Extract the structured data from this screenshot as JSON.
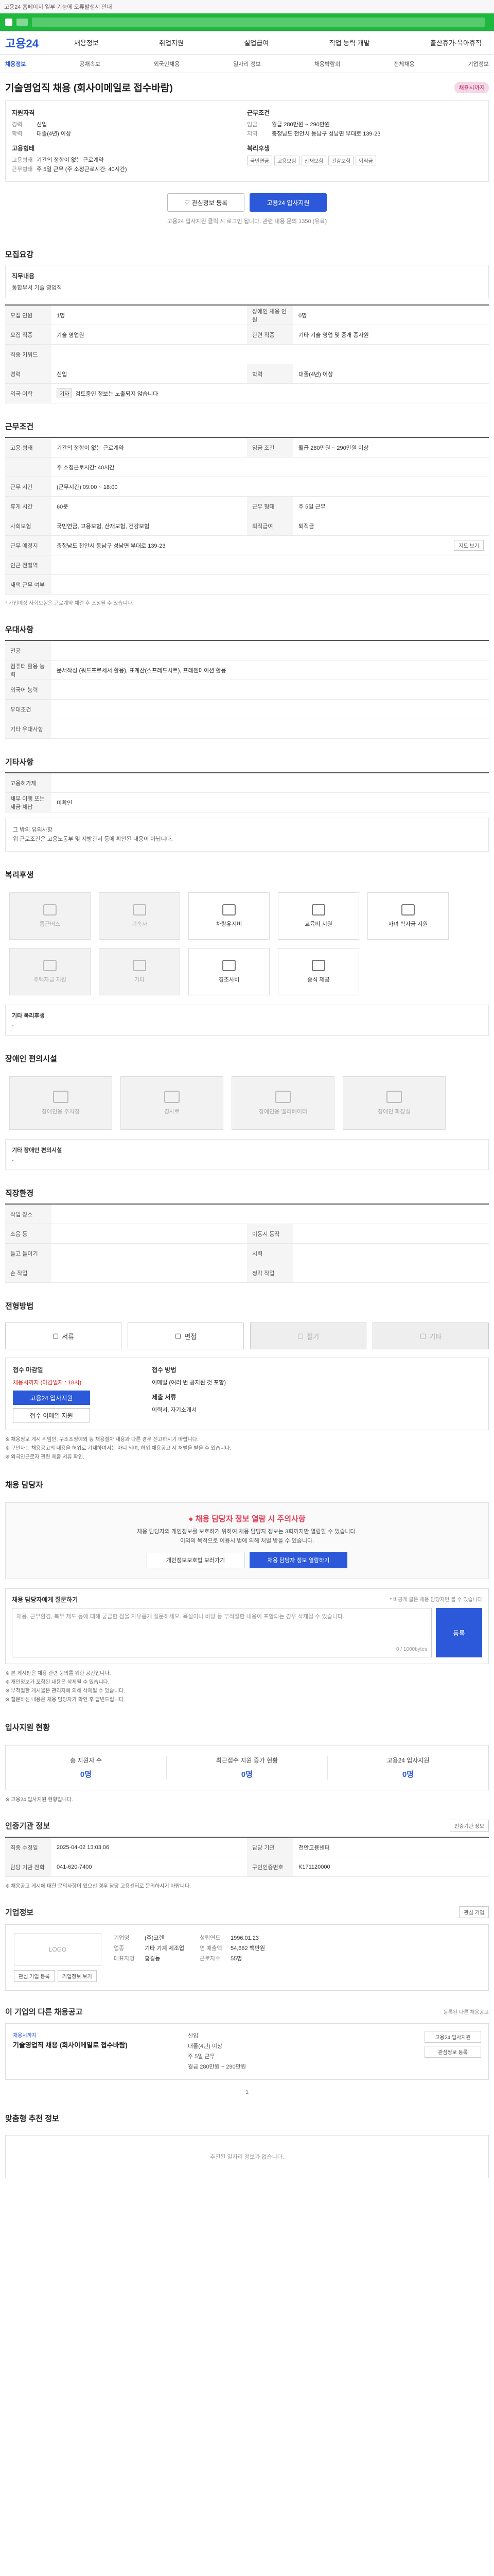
{
  "notice": {
    "text": "고용24 홈페이지 일부 기능에 오류발생시 안내"
  },
  "site": {
    "logo": "고용24"
  },
  "gnb": {
    "items": [
      "채용정보",
      "취업지원",
      "실업급여",
      "직업 능력 개발",
      "출산휴가·육아휴직"
    ]
  },
  "snb": {
    "items": [
      "채용정보",
      "공채속보",
      "외국인채용",
      "일자리 정보",
      "채용박람회",
      "전체채용",
      "기업정보"
    ]
  },
  "job": {
    "title": "기술영업직 채용 (회사이메일로 접수바람)",
    "badge": "채용시까지",
    "qualifications": {
      "heading": "지원자격",
      "rows": [
        {
          "k": "경력",
          "v": "신입"
        },
        {
          "k": "학력",
          "v": "대졸(4년) 이상"
        }
      ]
    },
    "conditions": {
      "heading": "근무조건",
      "rows": [
        {
          "k": "임금",
          "v": "월급 280만원 ~ 290만원"
        },
        {
          "k": "지역",
          "v": "충청남도 천안시 동남구 성남면 부대로 139-23"
        }
      ]
    },
    "employment": {
      "heading": "고용형태",
      "rows": [
        {
          "k": "고용형태",
          "v": "기간의 정함이 없는 근로계약"
        },
        {
          "k": "근무형태",
          "v": "주 5일 근무 (주 소정근로시간: 40시간)"
        }
      ]
    },
    "benefits": {
      "heading": "복리후생",
      "chips": [
        "국민연금",
        "고용보험",
        "산재보험",
        "건강보험",
        "퇴직금"
      ]
    },
    "buttons": {
      "favorite": "관심정보 등록",
      "apply": "고용24 입사지원"
    },
    "help": "고용24 입사지원 클릭 시 로그인 됩니다. 관련 내용 문의 1350 (유료)"
  },
  "recruit": {
    "title": "모집요강",
    "sub": {
      "title": "직무내용",
      "value": "통합부서 기술 영업직"
    },
    "rows": [
      {
        "k": "모집 인원",
        "v": "1명",
        "k2": "장애인 채용 인원",
        "v2": "0명"
      },
      {
        "k": "모집 직종",
        "v": "기술 영업원",
        "k2": "관련 직종",
        "v2": "기타 기술 영업 및 중개 종사원"
      },
      {
        "k": "직종 키워드",
        "v": "",
        "k2": "",
        "v2": ""
      },
      {
        "k": "경력",
        "v": "신입",
        "k2": "학력",
        "v2": "대졸(4년) 이상"
      },
      {
        "k": "외국 어학",
        "v": "검토중인 정보는 노출되지 않습니다",
        "k2": "",
        "v2": ""
      }
    ],
    "lang_chip": "기타"
  },
  "work": {
    "title": "근무조건",
    "rows": [
      {
        "k": "고용 형태",
        "v": "기간의 정함이 없는 근로계약",
        "k2": "임금 조건",
        "v2": "월급 280만원 ~ 290만원 이상"
      },
      {
        "k": "",
        "v": "주 소정근로시간: 40시간",
        "k2": "",
        "v2": ""
      },
      {
        "k": "근무 시간",
        "v": "(근무시간) 09:00 ~ 18:00",
        "k2": "",
        "v2": ""
      },
      {
        "k": "휴게 시간",
        "v": "60분",
        "k2": "근무 형태",
        "v2": "주 5일 근무"
      },
      {
        "k": "사회보험",
        "v": "국민연금, 고용보험, 산재보험, 건강보험",
        "k2": "퇴직급여",
        "v2": "퇴직금"
      },
      {
        "k": "근무 예정지",
        "v": "충청남도 천안시 동남구 성남면 부대로 139-23",
        "k2": "",
        "v2": ""
      },
      {
        "k": "인근 전철역",
        "v": "",
        "k2": "",
        "v2": ""
      },
      {
        "k": "재택 근무 여부",
        "v": "",
        "k2": "",
        "v2": ""
      }
    ],
    "more_label": "지도 보기",
    "note": "* 가입예정 사회보험은 근로계약 체결 후 조정될 수 있습니다."
  },
  "prefer": {
    "title": "우대사항",
    "rows": [
      {
        "k": "전공",
        "v": ""
      },
      {
        "k": "컴퓨터 활용 능력",
        "v": "문서작성 (워드프로세서 활용), 표계산(스프레드시트), 프레젠테이션 활용"
      },
      {
        "k": "외국어 능력",
        "v": ""
      },
      {
        "k": "우대조건",
        "v": ""
      },
      {
        "k": "기타 우대사항",
        "v": ""
      }
    ]
  },
  "etc": {
    "title": "기타사항",
    "rows": [
      {
        "k": "고용허가제",
        "v": ""
      },
      {
        "k": "채무 이행 또는 세금 체납",
        "v": "미확인"
      }
    ],
    "box_text": [
      "그 밖의 유의사항",
      "위 근로조건은 고용노동부 및 지방관서 등에 확인된 내용이 아닙니다."
    ]
  },
  "welfare": {
    "title": "복리후생",
    "items": [
      {
        "label": "통근버스",
        "dim": true
      },
      {
        "label": "기숙사",
        "dim": true
      },
      {
        "label": "차량유지비",
        "dim": false
      },
      {
        "label": "교육비 지원",
        "dim": false
      },
      {
        "label": "자녀 학자금 지원",
        "dim": false
      },
      {
        "label": "주택자금 지원",
        "dim": true
      },
      {
        "label": "기타",
        "dim": true
      },
      {
        "label": "경조사비",
        "dim": false
      },
      {
        "label": "중식 제공",
        "dim": false
      }
    ],
    "sub_title": "기타 복리후생",
    "sub_value": "-"
  },
  "facility": {
    "title": "장애인 편의시설",
    "items": [
      "장애인용 주차장",
      "경사로",
      "장애인용 엘리베이터",
      "장애인 화장실"
    ],
    "sub_title": "기타 장애인 편의시설",
    "sub_value": "-"
  },
  "company_env": {
    "title": "직장환경",
    "rows": [
      {
        "k": "작업 장소",
        "v": "",
        "k2": "",
        "v2": ""
      },
      {
        "k": "소음 등",
        "v": "",
        "k2": "이동시 동작",
        "v2": ""
      },
      {
        "k": "들고 들이기",
        "v": "",
        "k2": "시력",
        "v2": ""
      },
      {
        "k": "손 작업",
        "v": "",
        "k2": "청각 작업",
        "v2": ""
      }
    ]
  },
  "process": {
    "title": "전형방법",
    "tabs": [
      {
        "label": "서류",
        "dim": false
      },
      {
        "label": "면접",
        "dim": false
      },
      {
        "label": "필기",
        "dim": true
      },
      {
        "label": "기타",
        "dim": true
      }
    ],
    "deadline_title": "접수 마감일",
    "deadline_value": "채용시까지 (마감일자 : 18시)",
    "apply_btn": "고용24 입사지원",
    "email_btn": "접수 이메일 지원",
    "method_title": "접수 방법",
    "method_value": "이메일 (여러 번 공지된 것 포함)",
    "docs_title": "제출 서류",
    "docs_value": "이력서, 자기소개서",
    "notes": [
      "※ 채용정보 게시 위임인, 구조조정예외 등 채용절차 내용과 다른 경우 신고하시기 바랍니다.",
      "※ 구인자는 채용공고의 내용을 허위로 기재하여서는 아니 되며, 허위 채용공고 시 처벌을 받을 수 있습니다.",
      "※ 외국인근로자 관련 제출 서류 확인."
    ]
  },
  "contact": {
    "title": "채용 담당자",
    "warn_title": "채용 담당자 정보 열람 시 주의사항",
    "warn_sub": [
      "채용 담당자의 개인정보를 보호하기 위하여 채용 담당자 정보는 3회까지만 열람할 수 있습니다.",
      "이외의 목적으로 이용시 법에 의해 처벌 받을 수 있습니다."
    ],
    "btn_out": "개인정보보호법 보러가기",
    "btn_blue": "채용 담당자 정보 열람하기"
  },
  "review": {
    "title": "채용 담당자에게 질문하기",
    "note": "* 비공개 글은 채용 담당자만 볼 수 있습니다",
    "placeholder": "채용, 근무환경, 복무 제도 등에 대해 궁금한 점을 자유롭게 질문하세요. 욕설이나 비방 등 부적절한 내용이 포함되는 경우 삭제될 수 있습니다.",
    "counter": "0 / 1000bytes",
    "submit": "등록",
    "notes": [
      "※ 본 게시판은 채용 관련 문의를 위한 공간입니다.",
      "※ 개인정보가 포함된 내용은 삭제될 수 있습니다.",
      "※ 부적절한 게시물은 관리자에 의해 삭제될 수 있습니다.",
      "※ 질문하신 내용은 채용 담당자가 확인 후 답변드립니다."
    ]
  },
  "stats": {
    "title": "입사지원 현황",
    "items": [
      {
        "label": "총 지원자 수",
        "value": "0명"
      },
      {
        "label": "최근접수 지원 증가 현황",
        "value": "0명"
      },
      {
        "label": "고용24 입사지원",
        "value": "0명"
      }
    ],
    "note": "※ 고용24 입사지원 현황입니다."
  },
  "agency": {
    "title": "인증기관 정보",
    "btn": "인증기관 정보",
    "rows": [
      {
        "k": "최종 수정일",
        "v": "2025-04-02 13:03:06",
        "k2": "담당 기관",
        "v2": "천안고용센터"
      },
      {
        "k": "담당 기관 전화",
        "v": "041-620-7400",
        "k2": "구인인증번호",
        "v2": "K171120000"
      }
    ],
    "notes": [
      "※ 채용공고 게시에 대한 문의사항이 있으신 경우 담당 고용센터로 문의하시기 바랍니다."
    ]
  },
  "company": {
    "title": "기업정보",
    "btn": "관심 기업",
    "logo": "LOGO",
    "fields": [
      {
        "k": "기업명",
        "v": "(주)코렌"
      },
      {
        "k": "업종",
        "v": "기타 기계 제조업"
      },
      {
        "k": "대표자명",
        "v": "홍길동"
      },
      {
        "k": "설립연도",
        "v": "1996.01.23"
      },
      {
        "k": "연 매출액",
        "v": "54,682 백만원"
      },
      {
        "k": "근로자수",
        "v": "55명"
      }
    ],
    "sub_btns": [
      "관심 기업 등록",
      "기업정보 보기"
    ]
  },
  "other_jobs": {
    "title": "이 기업의 다른 채용공고",
    "subtitle": "등록된 다른 채용공고",
    "tag": "채용시까지",
    "job_title": "기술영업직 채용 (회사이메일로 접수바람)",
    "info": [
      "신입",
      "대졸(4년) 이상",
      "주 5일 근무",
      "월급 280만원 ~ 290만원"
    ],
    "btns": [
      "고용24 입사지원",
      "관심정보 등록"
    ],
    "pager": "1"
  },
  "recommend": {
    "title": "맞춤형 추천 정보",
    "empty": "추천된 일자리 정보가 없습니다."
  }
}
